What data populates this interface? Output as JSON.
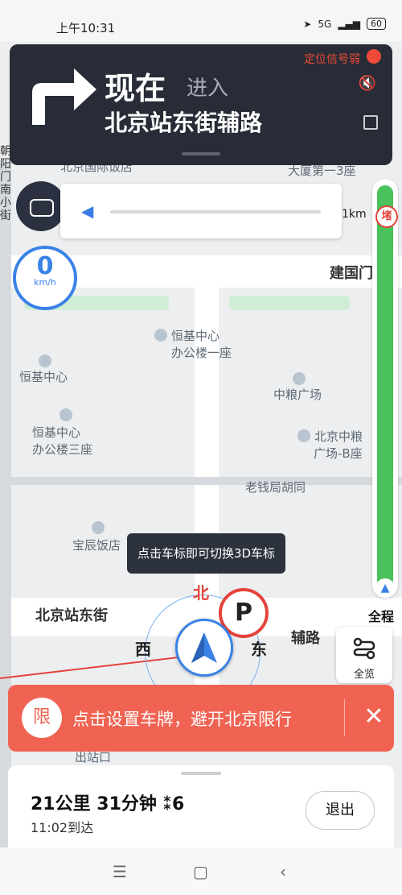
{
  "status_bar": {
    "time": "上午10:31",
    "network": "5G",
    "battery": "60"
  },
  "guidance": {
    "turn_icon": "turn-right-arrow-icon",
    "now": "现在",
    "action": "进入",
    "road": "北京站东街辅路",
    "signal_warning": "定位信号弱"
  },
  "map": {
    "pois": [
      "北京国际饭店",
      "大厦第一3座",
      "恒基中心",
      "办公楼一座",
      "恒基中心",
      "中粮广场",
      "恒基中心",
      "办公楼三座",
      "北京中粮",
      "广场-B座",
      "老钱局胡同",
      "宝辰饭店",
      "出站口"
    ],
    "streets": {
      "north_road": "建国门",
      "left_vertical": "朝阳门南小街",
      "main": "北京站东街",
      "fu_road": "辅路"
    },
    "compass": {
      "north": "北",
      "west": "西",
      "east": "东"
    },
    "parking": "P"
  },
  "speed": {
    "value": "0",
    "unit": "km/h"
  },
  "progress": {
    "remaining_km": "1km",
    "jam_label": "堵",
    "full_route": "全程"
  },
  "tooltip": "点击车标即可切换3D车标",
  "overview_label": "全览",
  "restriction": {
    "badge": "限",
    "text": "点击设置车牌，避开北京限行",
    "close": "✕"
  },
  "trip": {
    "summary": "21公里 31分钟 ⁑6",
    "arrive": "11:02到达",
    "exit": "退出"
  },
  "colors": {
    "accent": "#3a82e6",
    "alert": "#f06352",
    "route_green": "#4bc25b",
    "panel": "#272c36"
  }
}
